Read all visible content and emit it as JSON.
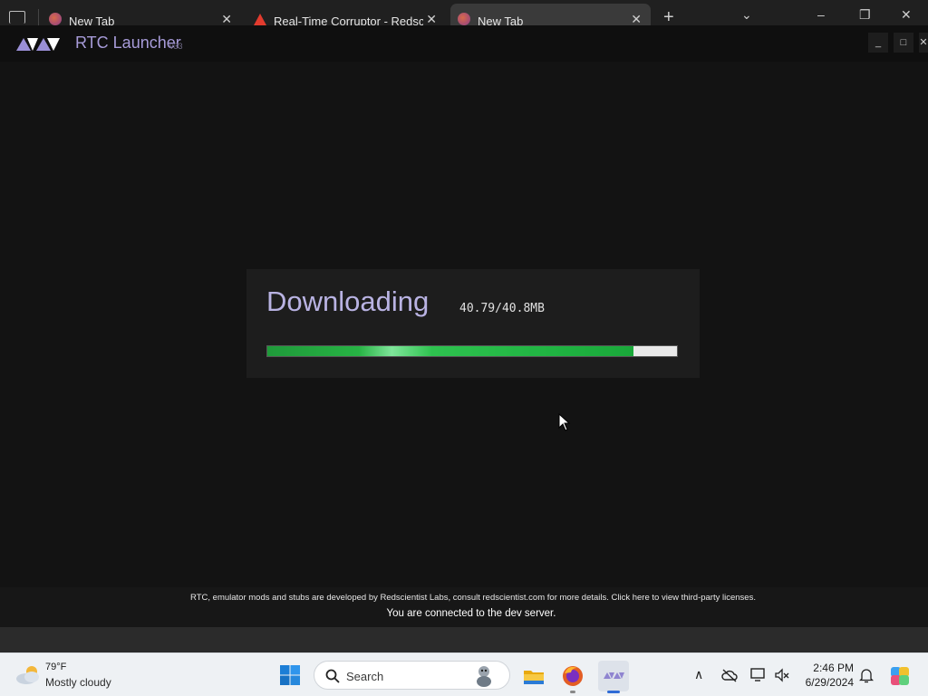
{
  "browser": {
    "tabs": [
      {
        "title": "New Tab",
        "favicon": "firefox-icon",
        "active": false
      },
      {
        "title": "Real-Time Corruptor - Redscientist",
        "favicon": "warning-icon",
        "active": false
      },
      {
        "title": "New Tab",
        "favicon": "firefox-icon",
        "active": true
      }
    ],
    "new_tab_glyph": "+",
    "tab_list_glyph": "⌄",
    "minimize_glyph": "–",
    "restore_glyph": "❐",
    "close_glyph": "✕",
    "tab_close_glyph": "✕"
  },
  "app": {
    "title": "RTC Launcher",
    "version": "v33",
    "header_buttons": {
      "minimize": "_",
      "maximize": "□",
      "close": "✕"
    },
    "download": {
      "heading": "Downloading",
      "size": "40.79/40.8MB",
      "progress": 0.893
    },
    "footer": {
      "note": "RTC, emulator mods and stubs are developed by Redscientist Labs, consult redscientist.com for more details. Click here to view third-party licenses.",
      "server_status": "You are connected to the dev server."
    },
    "colors": {
      "accent": "#a79bd9",
      "progress": "#27b344"
    }
  },
  "taskbar": {
    "weather": {
      "temp": "79°F",
      "desc": "Mostly cloudy",
      "icon": "cloudy-weather-icon"
    },
    "search_label": "Search",
    "apps": [
      "start-icon",
      "file-explorer-icon",
      "firefox-icon",
      "rtc-launcher-icon"
    ],
    "tray": {
      "chevron": "∧"
    },
    "clock": {
      "time": "2:46 PM",
      "date": "6/29/2024"
    }
  }
}
